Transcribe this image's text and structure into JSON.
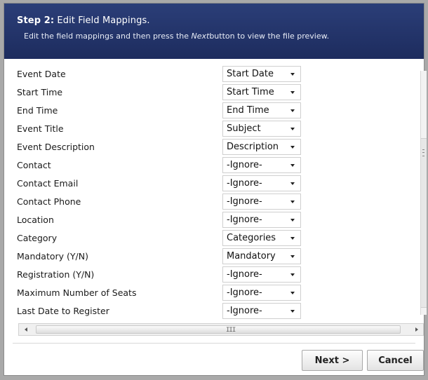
{
  "header": {
    "step_label": "Step 2:",
    "title": "Edit Field Mappings.",
    "instruction_pre": "Edit the field mappings and then press the ",
    "instruction_em": "Next",
    "instruction_post": "button to view the file preview."
  },
  "mappings": [
    {
      "field": "Event Date",
      "value": "Start Date"
    },
    {
      "field": "Start Time",
      "value": "Start Time"
    },
    {
      "field": "End Time",
      "value": "End Time"
    },
    {
      "field": "Event Title",
      "value": "Subject"
    },
    {
      "field": "Event Description",
      "value": "Description"
    },
    {
      "field": "Contact",
      "value": "-Ignore-"
    },
    {
      "field": "Contact Email",
      "value": "-Ignore-"
    },
    {
      "field": "Contact Phone",
      "value": "-Ignore-"
    },
    {
      "field": "Location",
      "value": "-Ignore-"
    },
    {
      "field": "Category",
      "value": "Categories"
    },
    {
      "field": "Mandatory (Y/N)",
      "value": "Mandatory"
    },
    {
      "field": "Registration (Y/N)",
      "value": "-Ignore-"
    },
    {
      "field": "Maximum Number of Seats",
      "value": "-Ignore-"
    },
    {
      "field": "Last Date to Register",
      "value": "-Ignore-"
    }
  ],
  "scrollbar": {
    "grip": "III"
  },
  "buttons": {
    "next": "Next >",
    "cancel": "Cancel"
  },
  "colors": {
    "header_bg": "#24346b",
    "page_bg": "#a9a9a9"
  },
  "icons": {
    "select_arrow": "chevron-down-icon",
    "scroll_left": "arrow-left-icon",
    "scroll_right": "arrow-right-icon"
  }
}
